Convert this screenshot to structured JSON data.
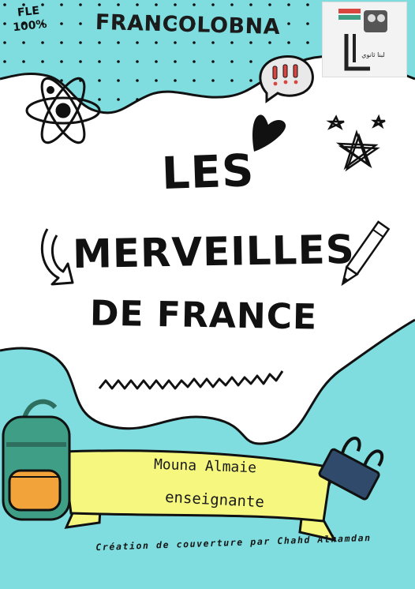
{
  "cover": {
    "badge_line1": "FLE",
    "badge_line2": "100%",
    "brand": "FRANCOLOBNA",
    "logo_text": "لبنا ثانوي",
    "title_line1": "LES",
    "title_line2": "MERVEILLES",
    "title_line3": "DE FRANCE",
    "author": "Mouna Almaie",
    "role": "enseignante",
    "credit": "Création de couverture par Chahd Alhamdan"
  },
  "colors": {
    "teal": "#7fdde0",
    "ink": "#111111",
    "banner_yellow": "#f5f77f",
    "backpack_green": "#3e9e86",
    "backpack_orange": "#f2a33a",
    "clip_navy": "#2f4a6b",
    "speech_red": "#d9463f"
  },
  "icons": [
    "atom-icon",
    "speech-bubble-icon",
    "heart-icon",
    "star-doodle-icon",
    "arrow-doodle-icon",
    "pencil-icon",
    "zigzag-line",
    "backpack-icon",
    "binder-clip-icon",
    "logo-icon"
  ]
}
